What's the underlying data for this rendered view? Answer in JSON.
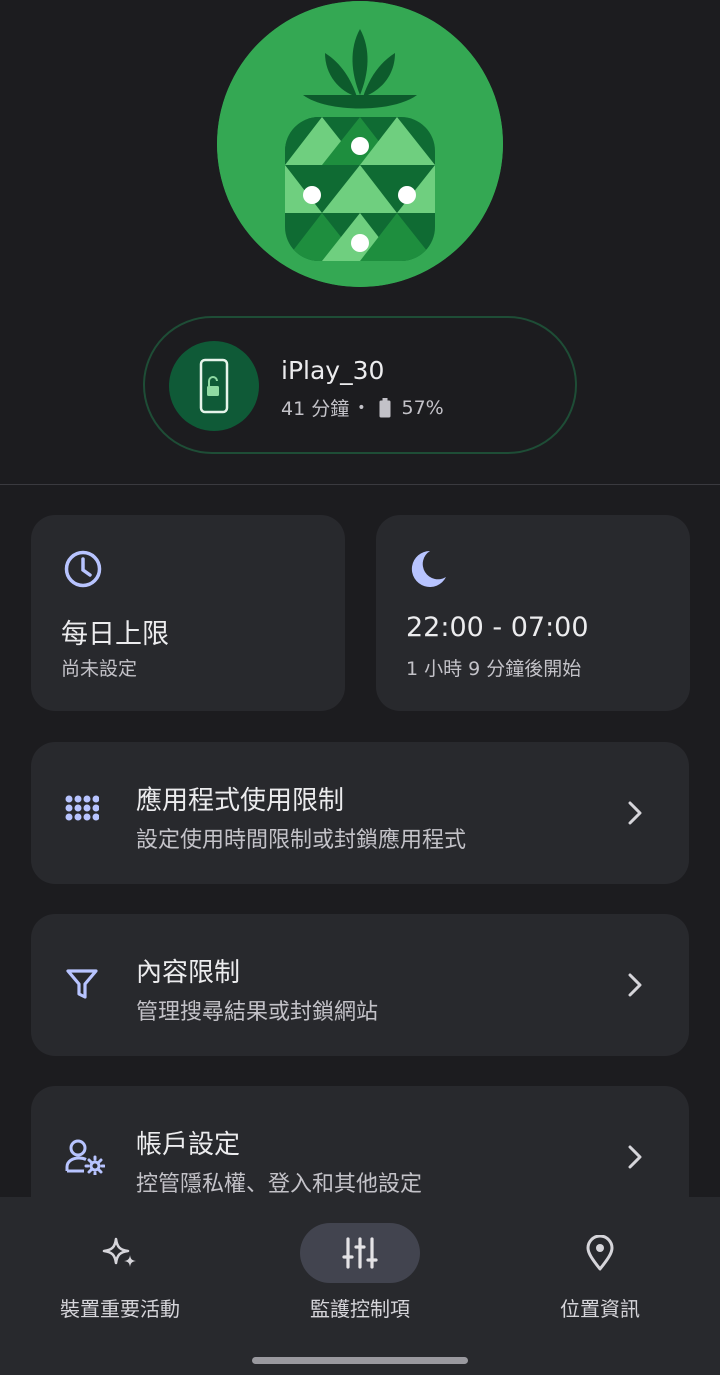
{
  "device": {
    "name": "iPlay_30",
    "screen_time": "41 分鐘",
    "separator": "•",
    "battery": "57%"
  },
  "cards": {
    "daily_limit": {
      "title": "每日上限",
      "subtitle": "尚未設定"
    },
    "bedtime": {
      "title": "22:00 - 07:00",
      "subtitle": "1 小時 9 分鐘後開始"
    }
  },
  "rows": [
    {
      "title": "應用程式使用限制",
      "subtitle": "設定使用時間限制或封鎖應用程式",
      "icon": "apps-grid-icon"
    },
    {
      "title": "內容限制",
      "subtitle": "管理搜尋結果或封鎖網站",
      "icon": "filter-icon"
    },
    {
      "title": "帳戶設定",
      "subtitle": "控管隱私權、登入和其他設定",
      "icon": "account-settings-icon"
    }
  ],
  "nav": [
    {
      "label": "裝置重要活動",
      "icon": "sparkle-icon",
      "active": false
    },
    {
      "label": "監護控制項",
      "icon": "tune-icon",
      "active": true
    },
    {
      "label": "位置資訊",
      "icon": "location-pin-icon",
      "active": false
    }
  ],
  "colors": {
    "background": "#1c1c1f",
    "card": "#28292d",
    "accent": "#b8c4ff",
    "avatar_green": "#34a853"
  }
}
